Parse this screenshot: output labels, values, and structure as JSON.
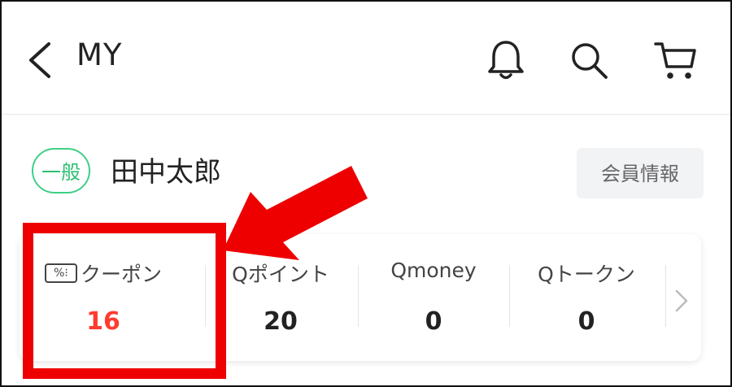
{
  "header": {
    "title": "MY",
    "icons": [
      "back-icon",
      "bell-icon",
      "search-icon",
      "cart-icon"
    ]
  },
  "member": {
    "badge": "一般",
    "name": "田中太郎",
    "info_button": "会員情報"
  },
  "stats": [
    {
      "label": "クーポン",
      "value": "16",
      "icon": "coupon-icon",
      "highlighted": true
    },
    {
      "label": "Qポイント",
      "value": "20"
    },
    {
      "label": "Qmoney",
      "value": "0"
    },
    {
      "label": "Qトークン",
      "value": "0"
    }
  ],
  "coupon_icon_text": "%⁝",
  "colors": {
    "badge_green": "#3fcf86",
    "highlight_red": "#ee0000",
    "coupon_value_red": "#ff3b30"
  }
}
